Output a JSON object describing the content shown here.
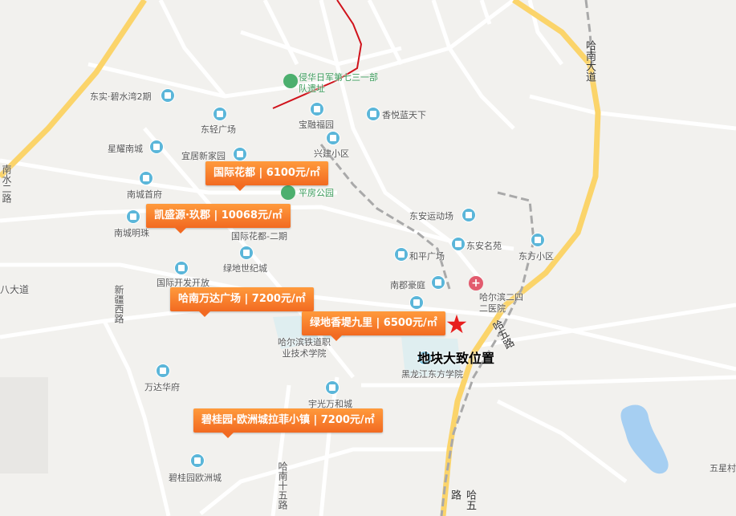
{
  "map": {
    "colors": {
      "background": "#f2f1ee",
      "road": "#ffffff",
      "highway": "#fbd46a",
      "metro": "#d0121b",
      "water": "#a6cff2",
      "price_tag": "#f26a21",
      "marker": "#e81e1e"
    }
  },
  "roads": {
    "bishui": "南水二路",
    "badadao": "八大道",
    "xinjiang": "新疆西路",
    "hanan_dadao": "哈南大道",
    "hanan15": "哈南十五路",
    "hawu": "哈五路",
    "hawu2": "哈五路"
  },
  "pois": {
    "dongshi": "东实·碧水湾2期",
    "dongqing": "东轻广场",
    "xingyao": "星耀南城",
    "nancheng": "南城首府",
    "yiju": "宜居新家园",
    "nanchengmingzhu": "南城明珠",
    "guoji2": "国际花都-二期",
    "lvdi": "绿地世纪城",
    "guojikaifa": "国际开发开放总部",
    "qinhua": "侵华日军第七三一部队遗址",
    "baorong": "宝融福园",
    "xiangyue": "香悦蓝天下",
    "xingjian": "兴建小区",
    "pingfang": "平房公园",
    "dongan_sport": "东安运动场",
    "dongan_mingyuan": "东安名苑",
    "dongfang": "东方小区",
    "heping": "和平广场",
    "nandu": "南郡豪庭",
    "hospital": "哈尔滨二四二医院",
    "tielu": "哈尔滨铁道职业技术学院",
    "wanda": "万达华府",
    "yuguang": "宇光万和城",
    "biguiyuan": "碧桂园欧洲城",
    "dongfang_college": "黑龙江东方学院",
    "wuxing": "五星村"
  },
  "tags": [
    {
      "label": "国际花都 | 6100元/㎡"
    },
    {
      "label": "凯盛源·玖郡 | 10068元/㎡"
    },
    {
      "label": "哈南万达广场 | 7200元/㎡"
    },
    {
      "label": "绿地香堤九里 | 6500元/㎡"
    },
    {
      "label": "碧桂园·欧洲城拉菲小镇 | 7200元/㎡"
    }
  ],
  "plot": {
    "label": "地块大致位置"
  }
}
